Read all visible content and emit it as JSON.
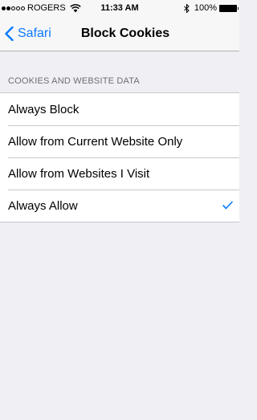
{
  "status_bar": {
    "carrier": "ROGERS",
    "signal_bars_filled": 2,
    "signal_bars_total": 5,
    "time": "11:33 AM",
    "battery": "100%"
  },
  "nav": {
    "back_label": "Safari",
    "title": "Block Cookies"
  },
  "section": {
    "header": "COOKIES AND WEBSITE DATA"
  },
  "options": [
    {
      "label": "Always Block",
      "selected": false
    },
    {
      "label": "Allow from Current Website Only",
      "selected": false
    },
    {
      "label": "Allow from Websites I Visit",
      "selected": false
    },
    {
      "label": "Always Allow",
      "selected": true
    }
  ],
  "colors": {
    "accent": "#0a7aff",
    "background": "#efeff4",
    "separator": "#c8c7cc",
    "section_header": "#6d6d72"
  }
}
